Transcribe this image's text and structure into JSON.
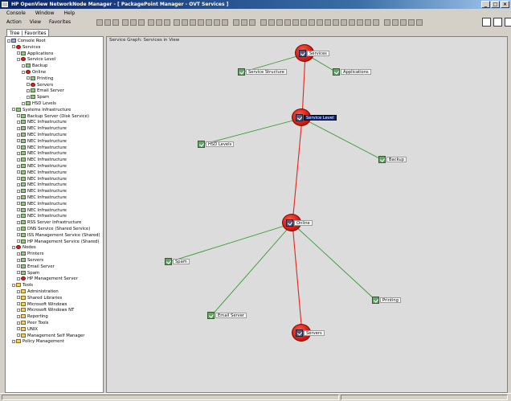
{
  "window": {
    "title": "HP OpenView NetworkNode Manager - [ PackagePoint Manager - OVT Services ]"
  },
  "menus": {
    "row1": [
      "Console",
      "Window",
      "Help"
    ],
    "row2": [
      "Action",
      "View",
      "Favorites"
    ]
  },
  "left_panel": {
    "tabs": [
      "Tree",
      "Favorites"
    ],
    "tree": [
      {
        "label": "Console Root",
        "indent": 0,
        "glyph": "comp"
      },
      {
        "label": "Services",
        "indent": 1,
        "glyph": "red"
      },
      {
        "label": "Applications",
        "indent": 2,
        "glyph": "check"
      },
      {
        "label": "Service Level",
        "indent": 2,
        "glyph": "red"
      },
      {
        "label": "Backup",
        "indent": 3,
        "glyph": "check"
      },
      {
        "label": "Online",
        "indent": 3,
        "glyph": "red"
      },
      {
        "label": "Printing",
        "indent": 4,
        "glyph": "check"
      },
      {
        "label": "Servers",
        "indent": 4,
        "glyph": "red"
      },
      {
        "label": "Email Server",
        "indent": 4,
        "glyph": "check"
      },
      {
        "label": "Spam",
        "indent": 4,
        "glyph": "check"
      },
      {
        "label": "HSD Levels",
        "indent": 3,
        "glyph": "check"
      },
      {
        "label": "Systems Infrastructure",
        "indent": 1,
        "glyph": "check"
      },
      {
        "label": "Backup Server (Disk Service)",
        "indent": 2,
        "glyph": "check"
      },
      {
        "label": "NEC Infrastructure",
        "indent": 2,
        "glyph": "check"
      },
      {
        "label": "NEC Infrastructure",
        "indent": 2,
        "glyph": "check"
      },
      {
        "label": "NEC Infrastructure",
        "indent": 2,
        "glyph": "check"
      },
      {
        "label": "NEC Infrastructure",
        "indent": 2,
        "glyph": "check"
      },
      {
        "label": "NEC Infrastructure",
        "indent": 2,
        "glyph": "check"
      },
      {
        "label": "NEC Infrastructure",
        "indent": 2,
        "glyph": "check"
      },
      {
        "label": "NEC Infrastructure",
        "indent": 2,
        "glyph": "check"
      },
      {
        "label": "NEC Infrastructure",
        "indent": 2,
        "glyph": "check"
      },
      {
        "label": "NEC Infrastructure",
        "indent": 2,
        "glyph": "check"
      },
      {
        "label": "NEC Infrastructure",
        "indent": 2,
        "glyph": "check"
      },
      {
        "label": "NEC Infrastructure",
        "indent": 2,
        "glyph": "check"
      },
      {
        "label": "NEC Infrastructure",
        "indent": 2,
        "glyph": "check"
      },
      {
        "label": "NEC Infrastructure",
        "indent": 2,
        "glyph": "check"
      },
      {
        "label": "NEC Infrastructure",
        "indent": 2,
        "glyph": "check"
      },
      {
        "label": "NEC Infrastructure",
        "indent": 2,
        "glyph": "check"
      },
      {
        "label": "NEC Infrastructure",
        "indent": 2,
        "glyph": "check"
      },
      {
        "label": "RSS Server Infrastructure",
        "indent": 2,
        "glyph": "check"
      },
      {
        "label": "DNS Service (Shared Service)",
        "indent": 2,
        "glyph": "check"
      },
      {
        "label": "ISS Management Service (Shared)",
        "indent": 2,
        "glyph": "check"
      },
      {
        "label": "HP Management Service (Shared)",
        "indent": 2,
        "glyph": "check"
      },
      {
        "label": "Nodes",
        "indent": 1,
        "glyph": "red"
      },
      {
        "label": "Printers",
        "indent": 2,
        "glyph": "check"
      },
      {
        "label": "Servers",
        "indent": 2,
        "glyph": "check"
      },
      {
        "label": "Email Server",
        "indent": 2,
        "glyph": "check"
      },
      {
        "label": "Spam",
        "indent": 2,
        "glyph": "check"
      },
      {
        "label": "HP Management Server",
        "indent": 2,
        "glyph": "red"
      },
      {
        "label": "Tools",
        "indent": 1,
        "glyph": "folder"
      },
      {
        "label": "Administration",
        "indent": 2,
        "glyph": "folder"
      },
      {
        "label": "Shared Libraries",
        "indent": 2,
        "glyph": "folder"
      },
      {
        "label": "Microsoft Windows",
        "indent": 2,
        "glyph": "folder"
      },
      {
        "label": "Microsoft Windows NT",
        "indent": 2,
        "glyph": "folder"
      },
      {
        "label": "Reporting",
        "indent": 2,
        "glyph": "folder"
      },
      {
        "label": "Peer Tools",
        "indent": 2,
        "glyph": "folder"
      },
      {
        "label": "UNIX",
        "indent": 2,
        "glyph": "folder"
      },
      {
        "label": "Management Self Manager",
        "indent": 2,
        "glyph": "folder"
      },
      {
        "label": "Policy Management",
        "indent": 1,
        "glyph": "folder"
      }
    ]
  },
  "canvas": {
    "caption": "Service Graph: Services in View",
    "nodes": [
      {
        "id": "services",
        "label": "Services",
        "red": true
      },
      {
        "id": "service-structure",
        "label": "Service Structure",
        "red": false
      },
      {
        "id": "applications",
        "label": "Applications",
        "red": false
      },
      {
        "id": "service-level",
        "label": "Service Level",
        "red": true,
        "selected": true
      },
      {
        "id": "hsd-levels",
        "label": "HSD Levels",
        "red": false
      },
      {
        "id": "backup",
        "label": "Backup",
        "red": false
      },
      {
        "id": "online",
        "label": "Online",
        "red": true
      },
      {
        "id": "spam",
        "label": "Spam",
        "red": false
      },
      {
        "id": "email-server",
        "label": "Email Server",
        "red": false
      },
      {
        "id": "printing",
        "label": "Printing",
        "red": false
      },
      {
        "id": "servers",
        "label": "Servers",
        "red": true
      }
    ],
    "edges": [
      {
        "from": "services",
        "to": "service-structure",
        "kind": "ok"
      },
      {
        "from": "services",
        "to": "applications",
        "kind": "ok"
      },
      {
        "from": "services",
        "to": "service-level",
        "kind": "critical"
      },
      {
        "from": "service-level",
        "to": "hsd-levels",
        "kind": "ok"
      },
      {
        "from": "service-level",
        "to": "backup",
        "kind": "ok"
      },
      {
        "from": "service-level",
        "to": "online",
        "kind": "critical"
      },
      {
        "from": "online",
        "to": "spam",
        "kind": "ok"
      },
      {
        "from": "online",
        "to": "email-server",
        "kind": "ok"
      },
      {
        "from": "online",
        "to": "printing",
        "kind": "ok"
      },
      {
        "from": "online",
        "to": "servers",
        "kind": "critical"
      }
    ],
    "colors": {
      "critical": "#e0241a",
      "ok": "#2e9a2e"
    }
  }
}
